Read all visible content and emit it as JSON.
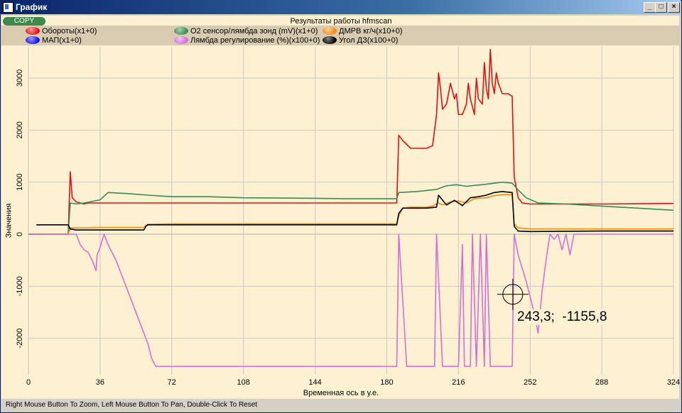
{
  "window": {
    "title": "График",
    "buttons": [
      "_",
      "□",
      "×"
    ]
  },
  "toolbar": {
    "copy_label": "COPY"
  },
  "status_text": "Right Mouse Button To Zoom, Left Mouse Button To Pan, Double-Click To Reset",
  "crosshair_readout": "243,3;  -1155,8",
  "chart_data": {
    "type": "line",
    "title": "Результаты работы hfmscan",
    "xlabel": "Временная ось в у.е.",
    "ylabel": "Значения",
    "xlim": [
      0,
      324
    ],
    "ylim": [
      -2700,
      3600
    ],
    "xticks": [
      0,
      36,
      72,
      108,
      144,
      180,
      216,
      252,
      288,
      324
    ],
    "yticks": [
      -2000,
      -1000,
      0,
      1000,
      2000,
      3000
    ],
    "grid": true,
    "legend_position": "top",
    "crosshair": [
      243.3,
      -1155.8
    ],
    "series": [
      {
        "name": "Обороты(x1+0)",
        "color": "#e01010",
        "points": [
          [
            0,
            0
          ],
          [
            20,
            0
          ],
          [
            21,
            1200
          ],
          [
            22,
            700
          ],
          [
            24,
            620
          ],
          [
            28,
            580
          ],
          [
            30,
            600
          ],
          [
            36,
            600
          ],
          [
            72,
            600
          ],
          [
            108,
            600
          ],
          [
            144,
            600
          ],
          [
            170,
            600
          ],
          [
            185,
            600
          ],
          [
            186,
            1900
          ],
          [
            188,
            1800
          ],
          [
            192,
            1650
          ],
          [
            200,
            1650
          ],
          [
            203,
            1700
          ],
          [
            204,
            2000
          ],
          [
            205,
            2300
          ],
          [
            206,
            3100
          ],
          [
            207,
            2800
          ],
          [
            208,
            2400
          ],
          [
            210,
            2500
          ],
          [
            212,
            2900
          ],
          [
            214,
            2600
          ],
          [
            215,
            2700
          ],
          [
            216,
            2300
          ],
          [
            218,
            2300
          ],
          [
            220,
            2500
          ],
          [
            221,
            2900
          ],
          [
            222,
            2600
          ],
          [
            224,
            2300
          ],
          [
            225,
            3000
          ],
          [
            226,
            2600
          ],
          [
            228,
            2500
          ],
          [
            229,
            3300
          ],
          [
            230,
            2800
          ],
          [
            231,
            2600
          ],
          [
            232,
            3550
          ],
          [
            233,
            2900
          ],
          [
            234,
            2700
          ],
          [
            235,
            3100
          ],
          [
            236,
            2900
          ],
          [
            238,
            2700
          ],
          [
            241,
            2700
          ],
          [
            243,
            2650
          ],
          [
            244,
            1100
          ],
          [
            246,
            700
          ],
          [
            248,
            600
          ],
          [
            252,
            580
          ],
          [
            288,
            580
          ],
          [
            324,
            590
          ]
        ]
      },
      {
        "name": "О2 сенсор/лямбда зонд (mV)(x1+0)",
        "color": "#3a8a55",
        "points": [
          [
            0,
            0
          ],
          [
            20,
            0
          ],
          [
            21,
            600
          ],
          [
            24,
            580
          ],
          [
            28,
            600
          ],
          [
            36,
            660
          ],
          [
            40,
            800
          ],
          [
            50,
            780
          ],
          [
            60,
            750
          ],
          [
            72,
            720
          ],
          [
            90,
            720
          ],
          [
            108,
            700
          ],
          [
            144,
            690
          ],
          [
            160,
            680
          ],
          [
            185,
            680
          ],
          [
            186,
            800
          ],
          [
            195,
            820
          ],
          [
            205,
            860
          ],
          [
            210,
            930
          ],
          [
            215,
            950
          ],
          [
            220,
            920
          ],
          [
            230,
            960
          ],
          [
            238,
            1000
          ],
          [
            243,
            980
          ],
          [
            246,
            850
          ],
          [
            250,
            700
          ],
          [
            256,
            600
          ],
          [
            270,
            580
          ],
          [
            288,
            540
          ],
          [
            324,
            460
          ]
        ]
      },
      {
        "name": "ДМРВ кг/ч(x10+0)",
        "color": "#f08c10",
        "points": [
          [
            0,
            0
          ],
          [
            20,
            0
          ],
          [
            21,
            120
          ],
          [
            24,
            120
          ],
          [
            28,
            120
          ],
          [
            36,
            130
          ],
          [
            58,
            130
          ],
          [
            59,
            170
          ],
          [
            60,
            190
          ],
          [
            72,
            200
          ],
          [
            108,
            200
          ],
          [
            144,
            200
          ],
          [
            160,
            200
          ],
          [
            185,
            200
          ],
          [
            186,
            350
          ],
          [
            188,
            500
          ],
          [
            192,
            520
          ],
          [
            200,
            520
          ],
          [
            203,
            540
          ],
          [
            206,
            600
          ],
          [
            208,
            560
          ],
          [
            212,
            620
          ],
          [
            216,
            640
          ],
          [
            220,
            600
          ],
          [
            224,
            680
          ],
          [
            230,
            700
          ],
          [
            234,
            740
          ],
          [
            238,
            760
          ],
          [
            243,
            760
          ],
          [
            244,
            200
          ],
          [
            246,
            120
          ],
          [
            252,
            100
          ],
          [
            288,
            100
          ],
          [
            324,
            100
          ]
        ]
      },
      {
        "name": "МАП(x1+0)",
        "color": "#1010e0",
        "points": []
      },
      {
        "name": "Лямбда регулирование (%)(x100+0)",
        "color": "#d070d8",
        "points": [
          [
            0,
            0
          ],
          [
            24,
            0
          ],
          [
            26,
            -200
          ],
          [
            28,
            -300
          ],
          [
            30,
            -350
          ],
          [
            32,
            -500
          ],
          [
            34,
            -700
          ],
          [
            34.5,
            -400
          ],
          [
            36,
            -250
          ],
          [
            38,
            0
          ],
          [
            40,
            -200
          ],
          [
            44,
            -500
          ],
          [
            48,
            -900
          ],
          [
            52,
            -1300
          ],
          [
            56,
            -1700
          ],
          [
            60,
            -2100
          ],
          [
            62,
            -2400
          ],
          [
            64,
            -2540
          ],
          [
            120,
            -2540
          ],
          [
            180,
            -2540
          ],
          [
            185,
            -2540
          ],
          [
            186,
            0
          ],
          [
            190,
            -2540
          ],
          [
            196,
            -2540
          ],
          [
            204,
            -2540
          ],
          [
            205,
            0
          ],
          [
            208,
            -2540
          ],
          [
            216,
            -2540
          ],
          [
            218,
            -200
          ],
          [
            219,
            -2540
          ],
          [
            222,
            -2540
          ],
          [
            223,
            0
          ],
          [
            225,
            -2540
          ],
          [
            227,
            0
          ],
          [
            229,
            -2540
          ],
          [
            230,
            0
          ],
          [
            232,
            -2540
          ],
          [
            243,
            -2540
          ],
          [
            244,
            0
          ],
          [
            246,
            -400
          ],
          [
            250,
            -900
          ],
          [
            254,
            -1500
          ],
          [
            256,
            -1900
          ],
          [
            258,
            -1100
          ],
          [
            260,
            -500
          ],
          [
            262,
            0
          ],
          [
            264,
            -100
          ],
          [
            266,
            0
          ],
          [
            268,
            -300
          ],
          [
            270,
            0
          ],
          [
            272,
            -400
          ],
          [
            274,
            0
          ],
          [
            324,
            0
          ]
        ]
      },
      {
        "name": "Угол ДЗ(x100+0)",
        "color": "#000000",
        "points": [
          [
            4,
            180
          ],
          [
            20,
            180
          ],
          [
            21,
            100
          ],
          [
            24,
            80
          ],
          [
            36,
            80
          ],
          [
            58,
            80
          ],
          [
            59,
            150
          ],
          [
            60,
            180
          ],
          [
            72,
            180
          ],
          [
            108,
            180
          ],
          [
            144,
            180
          ],
          [
            185,
            180
          ],
          [
            186,
            400
          ],
          [
            188,
            500
          ],
          [
            200,
            500
          ],
          [
            205,
            520
          ],
          [
            206,
            750
          ],
          [
            210,
            560
          ],
          [
            214,
            650
          ],
          [
            218,
            550
          ],
          [
            222,
            700
          ],
          [
            226,
            720
          ],
          [
            230,
            750
          ],
          [
            234,
            800
          ],
          [
            238,
            820
          ],
          [
            243,
            800
          ],
          [
            244,
            150
          ],
          [
            246,
            60
          ],
          [
            252,
            50
          ],
          [
            288,
            60
          ],
          [
            324,
            60
          ]
        ]
      }
    ]
  }
}
